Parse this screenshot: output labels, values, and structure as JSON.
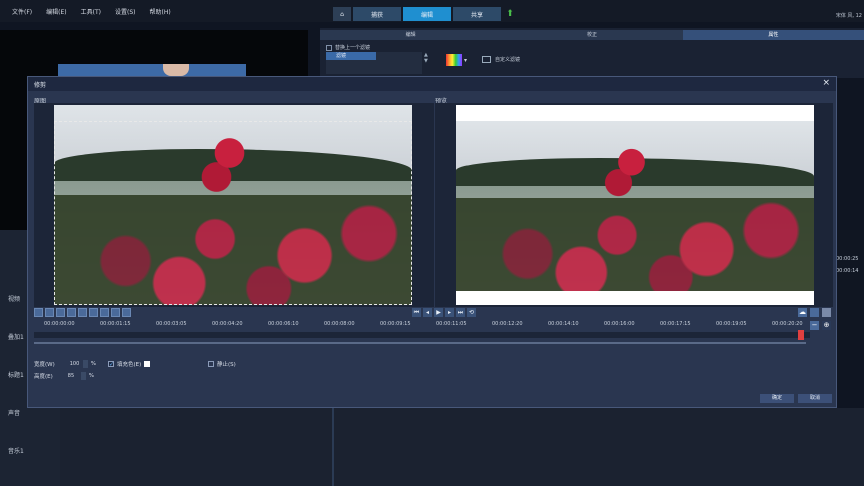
{
  "menu": [
    "文件(F)",
    "编辑(E)",
    "工具(T)",
    "设置(S)",
    "帮助(H)"
  ],
  "topnav": {
    "capture": "捕获",
    "edit": "编辑",
    "share": "共享"
  },
  "status_info": "宋体 风, 12",
  "right_panel": {
    "tabs": [
      "编辑",
      "校正",
      "属性"
    ],
    "checkbox_label": "替换上一个滤镜",
    "list_item": "滤镜",
    "custom_label": "自定义滤镜"
  },
  "left_tracks": [
    "视频",
    "叠加1",
    "标题1",
    "声音",
    "音乐1"
  ],
  "right_times": [
    "00:00:25",
    "00:00:14"
  ],
  "dialog": {
    "title": "修剪",
    "close": "×",
    "original_label": "原图",
    "preview_label": "预览",
    "timecodes": [
      "00:00:00:00",
      "00:00:01:15",
      "00:00:03:05",
      "00:00:04:20",
      "00:00:06:10",
      "00:00:08:00",
      "00:00:09:15",
      "00:00:11:05",
      "00:00:12:20",
      "00:00:14:10",
      "00:00:16:00",
      "00:00:17:15",
      "00:00:19:05",
      "00:00:20:20"
    ],
    "width_label": "宽度(W)",
    "width_value": "100",
    "height_label": "高度(E)",
    "height_value": "85",
    "unit": "%",
    "fill_color_label": "填充色(E)",
    "fill_color_checked": true,
    "static_label": "静止(S)",
    "static_checked": false,
    "ok_label": "确定",
    "cancel_label": "取消"
  },
  "colors": {
    "accent": "#1f8fd0",
    "dialog_bg": "#2a3650",
    "playhead": "#e04040"
  }
}
